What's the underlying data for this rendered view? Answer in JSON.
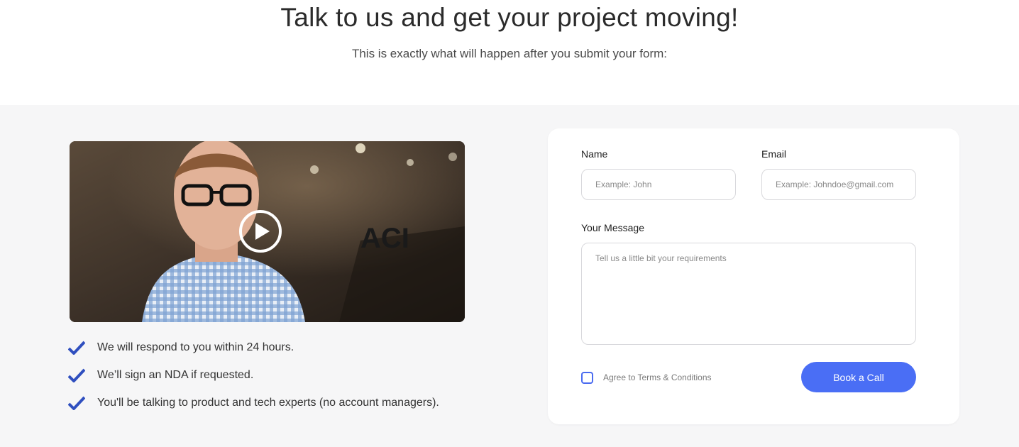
{
  "header": {
    "title": "Talk to us and get your project moving!",
    "subtitle": "This is exactly what will happen after you submit your form:"
  },
  "video": {
    "play_icon": "play-circle-icon",
    "wall_logo": "ACI"
  },
  "checklist": [
    {
      "icon": "checkmark-icon",
      "text": "We will respond to you within 24 hours."
    },
    {
      "icon": "checkmark-icon",
      "text": "We’ll sign an NDA if requested."
    },
    {
      "icon": "checkmark-icon",
      "text": "You'll be talking to product and tech experts (no account managers)."
    }
  ],
  "form": {
    "name_label": "Name",
    "name_placeholder": "Example: John",
    "name_value": "",
    "email_label": "Email",
    "email_placeholder": "Example: Johndoe@gmail.com",
    "email_value": "",
    "message_label": "Your Message",
    "message_placeholder": "Tell us a little bit your requirements",
    "message_value": "",
    "terms_label": "Agree to Terms & Conditions",
    "terms_checked": false,
    "submit_label": "Book a Call"
  },
  "colors": {
    "accent": "#4a6ef5",
    "checkmark": "#2f4fbf",
    "section_bg": "#f6f6f7"
  }
}
